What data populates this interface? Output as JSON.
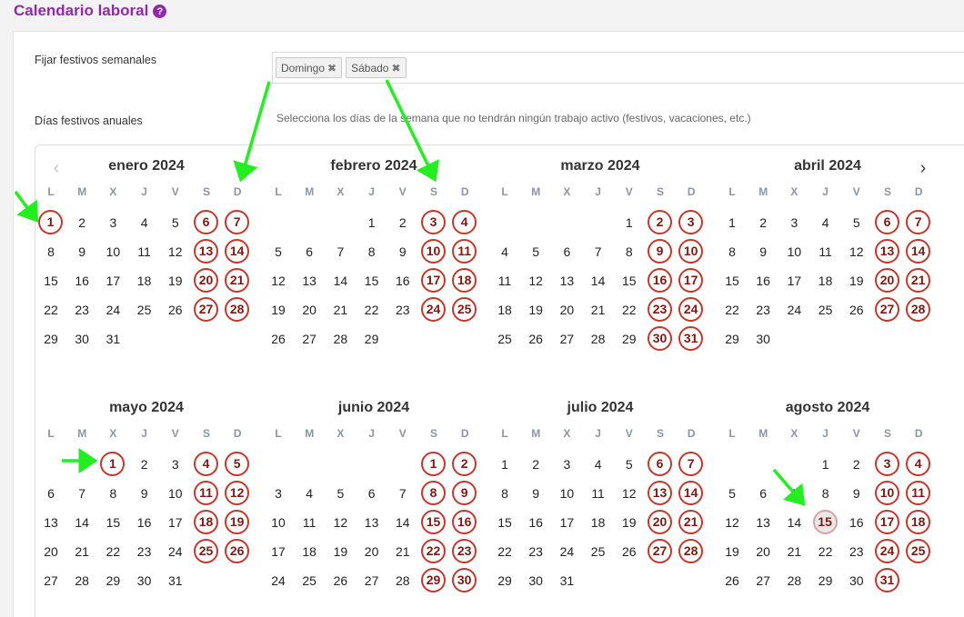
{
  "page": {
    "title": "Calendario laboral"
  },
  "weekly": {
    "label": "Fijar festivos semanales",
    "tags": [
      "Domingo",
      "Sábado"
    ],
    "help": "Selecciona los días de la semana que no tendrán ningún trabajo activo (festivos, vacaciones, etc.)"
  },
  "annual": {
    "label": "Días festivos anuales"
  },
  "calendar": {
    "nav": {
      "prev": "‹",
      "next": "›"
    },
    "weekdays": [
      "L",
      "M",
      "X",
      "J",
      "V",
      "S",
      "D"
    ],
    "months": [
      {
        "title": "enero 2024",
        "offset": 0,
        "days": 31,
        "holidays": [
          1,
          6,
          7,
          13,
          14,
          20,
          21,
          27,
          28
        ]
      },
      {
        "title": "febrero 2024",
        "offset": 3,
        "days": 29,
        "holidays": [
          3,
          4,
          10,
          11,
          17,
          18,
          24,
          25
        ]
      },
      {
        "title": "marzo 2024",
        "offset": 4,
        "days": 31,
        "holidays": [
          2,
          3,
          9,
          10,
          16,
          17,
          23,
          24,
          30,
          31
        ]
      },
      {
        "title": "abril 2024",
        "offset": 0,
        "days": 30,
        "holidays": [
          6,
          7,
          13,
          14,
          20,
          21,
          27,
          28
        ]
      },
      {
        "title": "mayo 2024",
        "offset": 2,
        "days": 31,
        "holidays": [
          1,
          4,
          5,
          11,
          12,
          18,
          19,
          25,
          26
        ]
      },
      {
        "title": "junio 2024",
        "offset": 5,
        "days": 30,
        "holidays": [
          1,
          2,
          8,
          9,
          15,
          16,
          22,
          23,
          29,
          30
        ]
      },
      {
        "title": "julio 2024",
        "offset": 0,
        "days": 31,
        "holidays": [
          6,
          7,
          13,
          14,
          20,
          21,
          27,
          28
        ]
      },
      {
        "title": "agosto 2024",
        "offset": 3,
        "days": 31,
        "holidays": [
          3,
          4,
          10,
          11,
          17,
          18,
          24,
          25,
          31
        ],
        "selected": [
          15
        ]
      }
    ]
  },
  "colors": {
    "title": "#8f2aa8",
    "holiday_ring": "#c0392b",
    "holiday_text": "#7a1a12",
    "arrow": "#22ee22"
  }
}
